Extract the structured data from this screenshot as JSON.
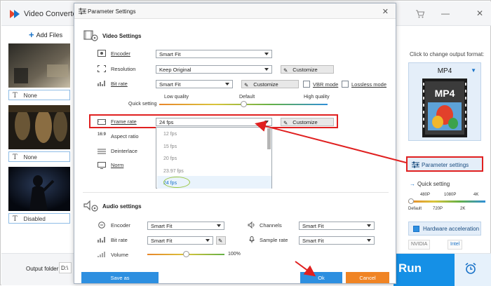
{
  "app": {
    "title": "Video Converter",
    "add_files": "Add Files",
    "output_folder_label": "Output folder:",
    "output_folder_value": "D:\\",
    "run_label": "Run"
  },
  "thumbnails": [
    {
      "subtitle": "None"
    },
    {
      "subtitle": "None"
    },
    {
      "subtitle": "Disabled"
    }
  ],
  "right_panel": {
    "click_change": "Click to change output format:",
    "format": "MP4",
    "format_card_text": "MP4",
    "parameter_settings": "Parameter settings",
    "quick_setting": "Quick setting",
    "quick_scale_top": [
      "480P",
      "1080P",
      "4K"
    ],
    "quick_scale_bottom": [
      "Default",
      "720P",
      "2K"
    ],
    "hardware_acceleration": "Hardware acceleration",
    "vendors": [
      "NVIDIA",
      "Intel"
    ]
  },
  "dialog": {
    "title": "Parameter Settings",
    "video_settings": {
      "heading": "Video Settings",
      "encoder_label": "Encoder",
      "encoder_value": "Smart Fit",
      "resolution_label": "Resolution",
      "resolution_value": "Keep Original",
      "customize": "Customize",
      "bitrate_label": "Bit rate",
      "bitrate_value": "Smart Fit",
      "vbr_mode": "VBR mode",
      "lossless_mode": "Lossless mode",
      "quick_setting": "Quick setting",
      "quality_low": "Low quality",
      "quality_default": "Default",
      "quality_high": "High quality",
      "quality_level": 0.5,
      "framerate_label": "Frame rate",
      "framerate_value": "24 fps",
      "aspect_ratio_label": "Aspect ratio",
      "deinterlace_label": "Deinterlace",
      "norm_label": "Norm",
      "fps_options": [
        "12 fps",
        "15 fps",
        "20 fps",
        "23.97 fps",
        "24 fps"
      ]
    },
    "audio_settings": {
      "heading": "Audio settings",
      "encoder_label": "Encoder",
      "encoder_value": "Smart Fit",
      "channels_label": "Channels",
      "channels_value": "Smart Fit",
      "bitrate_label": "Bit rate",
      "bitrate_value": "Smart Fit",
      "sample_rate_label": "Sample rate",
      "sample_rate_value": "Smart Fit",
      "volume_label": "Volume",
      "volume_value": "100%",
      "volume_level": 0.5
    },
    "save_as": "Save as",
    "ok": "Ok",
    "cancel": "Cancel"
  },
  "colors": {
    "accent_blue": "#2d8fe0",
    "annotation_red": "#e02020",
    "cancel_orange": "#f08424",
    "highlight_green": "#9ac640"
  }
}
